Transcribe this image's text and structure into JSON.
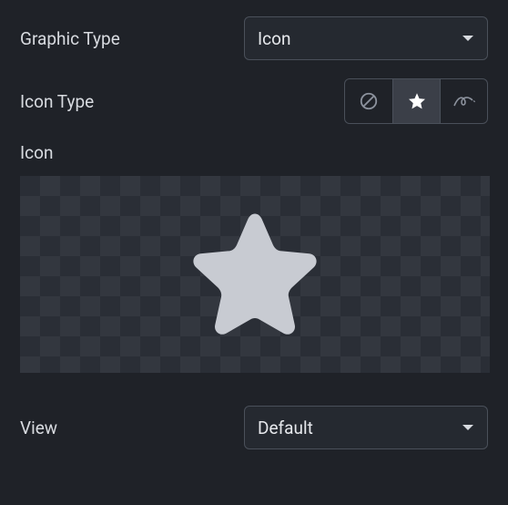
{
  "graphic_type": {
    "label": "Graphic Type",
    "value": "Icon"
  },
  "icon_type": {
    "label": "Icon Type",
    "options": [
      {
        "name": "none",
        "icon": "prohibit-icon",
        "active": false
      },
      {
        "name": "star",
        "icon": "star-icon",
        "active": true
      },
      {
        "name": "curve",
        "icon": "curve-icon",
        "active": false
      }
    ]
  },
  "icon_preview": {
    "label": "Icon",
    "preview_icon": "star",
    "preview_color": "#c8cbd2"
  },
  "view": {
    "label": "View",
    "value": "Default"
  },
  "colors": {
    "fill_active": "#ffffff",
    "stroke_inactive": "#8b919c"
  }
}
